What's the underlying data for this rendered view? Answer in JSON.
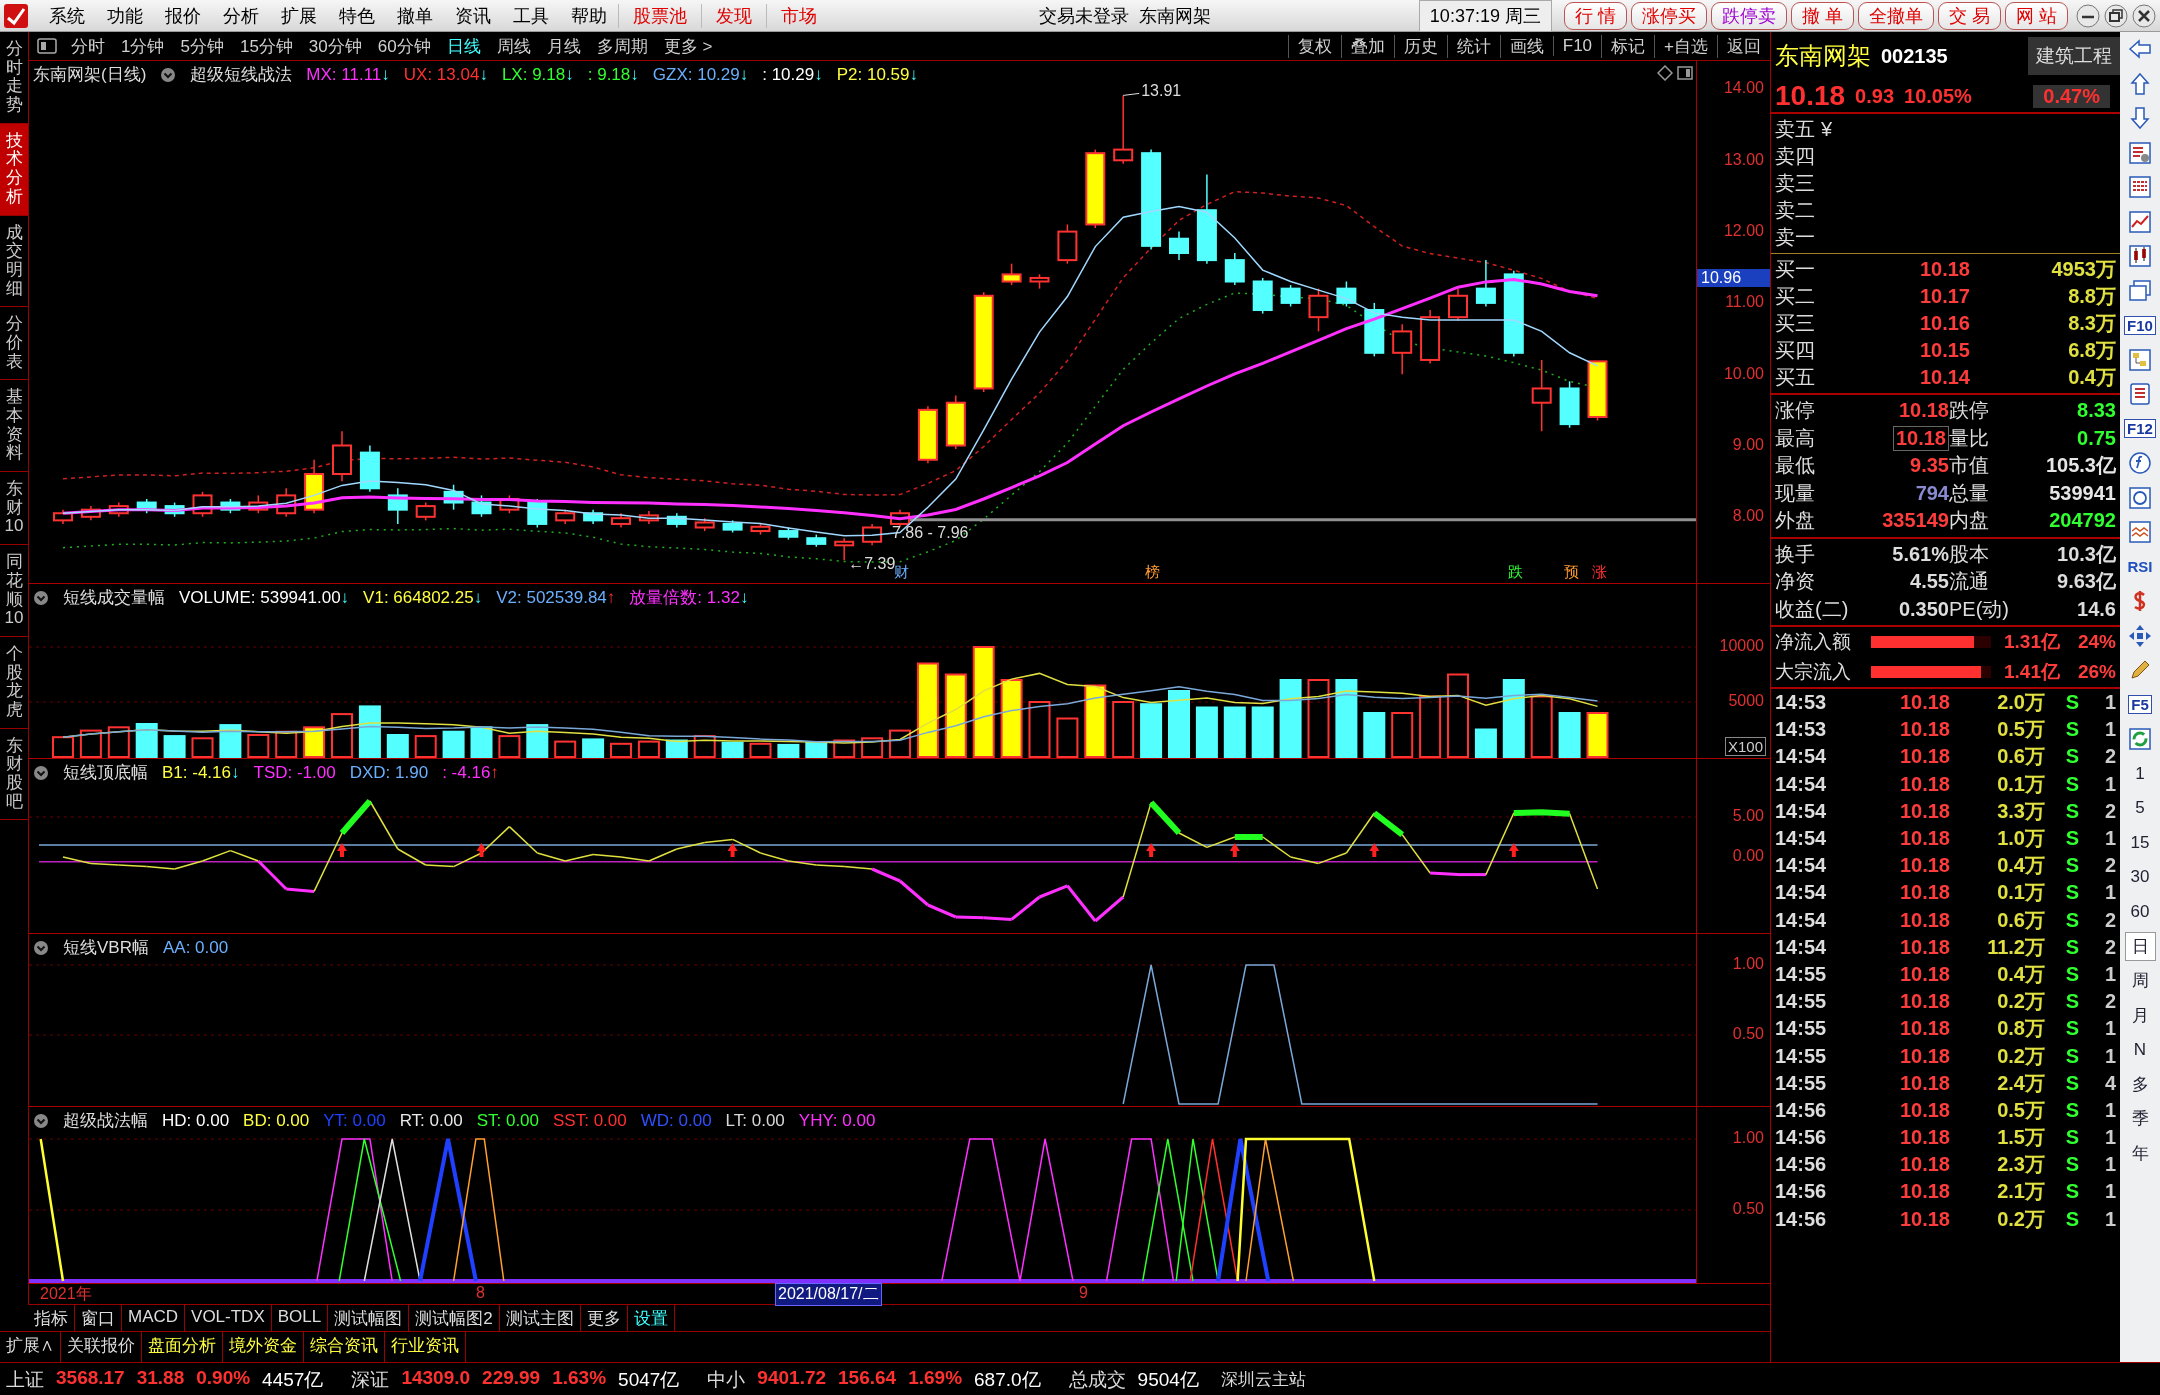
{
  "menu_bar": {
    "items": [
      {
        "label": "系统",
        "kind": "normal"
      },
      {
        "label": "功能",
        "kind": "normal"
      },
      {
        "label": "报价",
        "kind": "normal"
      },
      {
        "label": "分析",
        "kind": "normal"
      },
      {
        "label": "扩展",
        "kind": "normal"
      },
      {
        "label": "特色",
        "kind": "normal"
      },
      {
        "label": "撤单",
        "kind": "normal"
      },
      {
        "label": "资讯",
        "kind": "normal"
      },
      {
        "label": "工具",
        "kind": "normal"
      },
      {
        "label": "帮助",
        "kind": "normal"
      },
      {
        "label": "股票池",
        "kind": "highlight"
      },
      {
        "label": "发现",
        "kind": "highlight"
      },
      {
        "label": "市场",
        "kind": "highlight"
      }
    ],
    "status": "交易未登录  东南网架",
    "clock": "10:37:19 周三",
    "quick_buttons": [
      {
        "label": "行 情",
        "kind": "normal"
      },
      {
        "label": "涨停买",
        "kind": "normal"
      },
      {
        "label": "跌停卖",
        "kind": "accent"
      },
      {
        "label": "撤 单",
        "kind": "normal"
      },
      {
        "label": "全撤单",
        "kind": "normal"
      },
      {
        "label": "交 易",
        "kind": "normal"
      },
      {
        "label": "网 站",
        "kind": "normal"
      }
    ]
  },
  "period_tabs": [
    {
      "label": "分时",
      "selected": false
    },
    {
      "label": "1分钟",
      "selected": false
    },
    {
      "label": "5分钟",
      "selected": false
    },
    {
      "label": "15分钟",
      "selected": false
    },
    {
      "label": "30分钟",
      "selected": false
    },
    {
      "label": "60分钟",
      "selected": false
    },
    {
      "label": "日线",
      "selected": true
    },
    {
      "label": "周线",
      "selected": false
    },
    {
      "label": "月线",
      "selected": false
    },
    {
      "label": "多周期",
      "selected": false
    },
    {
      "label": "更多 >",
      "selected": false
    }
  ],
  "chart_tools": [
    "复权",
    "叠加",
    "历史",
    "统计",
    "画线",
    "F10",
    "标记",
    "+自选",
    "返回"
  ],
  "side_tabs": [
    {
      "label": "分时走势",
      "selected": false
    },
    {
      "label": "技术分析",
      "selected": true
    },
    {
      "label": "成交明细",
      "selected": false
    },
    {
      "label": "分价表",
      "selected": false
    },
    {
      "label": "基本资料",
      "selected": false
    },
    {
      "label": "东财10",
      "selected": false
    },
    {
      "label": "同花顺10",
      "selected": false
    },
    {
      "label": "个股龙虎",
      "selected": false
    },
    {
      "label": "东财股吧",
      "selected": false
    }
  ],
  "main_chart": {
    "title": "东南网架(日线)",
    "formula": "超级短线战法",
    "legend": [
      {
        "text": "MX: 11.11",
        "arrow": "↓",
        "kind": "down",
        "color": "#ff30ff"
      },
      {
        "text": "UX: 13.04",
        "arrow": "↓",
        "kind": "down",
        "color": "#ff3030"
      },
      {
        "text": "LX: 9.18",
        "arrow": "↓",
        "kind": "down",
        "color": "#30ff30"
      },
      {
        "text": ": 9.18",
        "arrow": "↓",
        "kind": "down",
        "color": "#30ff30"
      },
      {
        "text": "GZX: 10.29",
        "arrow": "↓",
        "kind": "down",
        "color": "#6ab0ff"
      },
      {
        "text": ": 10.29",
        "arrow": "↓",
        "kind": "down",
        "color": "#ffffff"
      },
      {
        "text": "P2: 10.59",
        "arrow": "↓",
        "kind": "down",
        "color": "#ffff40"
      }
    ],
    "axis": [
      "14.00",
      "13.00",
      "12.00",
      "11.00",
      "10.00",
      "9.00",
      "8.00"
    ],
    "price_tag": "10.96",
    "peak_label": "13.91",
    "range_label": "7.86 - 7.96",
    "low_label": "7.39",
    "low_arrow": "←",
    "markers": [
      {
        "text": "财",
        "kind": "news"
      },
      {
        "text": "榜",
        "kind": "rank"
      },
      {
        "text": "跌",
        "kind": "fall"
      },
      {
        "text": "预",
        "kind": "notice"
      },
      {
        "text": "涨",
        "kind": "rise"
      }
    ]
  },
  "volume_panel": {
    "title": "短线成交量幅",
    "legend": [
      {
        "text": "VOLUME: 539941.00",
        "arrow": "↓",
        "kind": "down",
        "color": "#ffffff"
      },
      {
        "text": "V1: 664802.25",
        "arrow": "↓",
        "kind": "down",
        "color": "#ffff40"
      },
      {
        "text": "V2: 502539.84",
        "arrow": "↑",
        "kind": "up",
        "color": "#6ab0ff"
      },
      {
        "text": "放量倍数: 1.32",
        "arrow": "↓",
        "kind": "down",
        "color": "#ff30ff"
      }
    ],
    "axis": [
      "10000",
      "5000"
    ],
    "unit": "X100"
  },
  "signal_panel": {
    "title": "短线顶底幅",
    "legend": [
      {
        "text": "B1: -4.16",
        "arrow": "↓",
        "kind": "down",
        "color": "#ffff40"
      },
      {
        "text": "TSD: -1.00",
        "color": "#ff30ff"
      },
      {
        "text": "DXD: 1.90",
        "color": "#6ab0ff"
      },
      {
        "text": ": -4.16",
        "arrow": "↑",
        "kind": "up",
        "color": "#ff30ff"
      }
    ],
    "axis": [
      "5.00",
      "0.00"
    ]
  },
  "vbr_panel": {
    "title": "短线VBR幅",
    "legend": [
      {
        "text": "AA: 0.00",
        "color": "#6ab0ff"
      }
    ],
    "axis": [
      "1.00",
      "0.50"
    ]
  },
  "strategy_panel": {
    "title": "超级战法幅",
    "legend": [
      {
        "text": "HD: 0.00",
        "color": "#ffffff"
      },
      {
        "text": "BD: 0.00",
        "color": "#ffff40"
      },
      {
        "text": "YT: 0.00",
        "color": "#2040ff"
      },
      {
        "text": "RT: 0.00",
        "color": "#e8e8e8"
      },
      {
        "text": "ST: 0.00",
        "color": "#30ff30"
      },
      {
        "text": "SST: 0.00",
        "color": "#ff3030"
      },
      {
        "text": "WD: 0.00",
        "color": "#3050ff"
      },
      {
        "text": "LT: 0.00",
        "color": "#d8d8d8"
      },
      {
        "text": "YHY: 0.00",
        "color": "#ff30ff"
      }
    ],
    "axis": [
      "1.00",
      "0.50"
    ]
  },
  "date_axis": [
    {
      "label": "2021年",
      "kind": "year"
    },
    {
      "label": "8",
      "kind": "month"
    },
    {
      "label": "2021/08/17/二",
      "kind": "cursor"
    },
    {
      "label": "9",
      "kind": "month"
    }
  ],
  "indicator_tabs": [
    {
      "label": "指标",
      "kind": "normal"
    },
    {
      "label": "窗口",
      "kind": "normal"
    },
    {
      "label": "MACD",
      "kind": "normal"
    },
    {
      "label": "VOL-TDX",
      "kind": "normal"
    },
    {
      "label": "BOLL",
      "kind": "normal"
    },
    {
      "label": "测试幅图",
      "kind": "normal"
    },
    {
      "label": "测试幅图2",
      "kind": "normal"
    },
    {
      "label": "测试主图",
      "kind": "normal"
    },
    {
      "label": "更多",
      "kind": "normal"
    },
    {
      "label": "设置",
      "kind": "accent"
    }
  ],
  "extension_tabs": [
    {
      "label": "扩展∧",
      "kind": "normal"
    },
    {
      "label": "关联报价",
      "kind": "normal"
    },
    {
      "label": "盘面分析",
      "kind": "accent"
    },
    {
      "label": "境外资金",
      "kind": "accent"
    },
    {
      "label": "综合资讯",
      "kind": "accent"
    },
    {
      "label": "行业资讯",
      "kind": "accent"
    }
  ],
  "quote": {
    "name": "东南网架",
    "code": "002135",
    "sector": "建筑工程",
    "price": "10.18",
    "change": "0.93",
    "pct": "10.05%",
    "sector_pct": "0.47%"
  },
  "sell_levels": [
    {
      "label": "卖五"
    },
    {
      "label": "卖四"
    },
    {
      "label": "卖三"
    },
    {
      "label": "卖二"
    },
    {
      "label": "卖一"
    }
  ],
  "currency": "¥",
  "buy_levels": [
    {
      "label": "买一",
      "price": "10.18",
      "volume": "4953万"
    },
    {
      "label": "买二",
      "price": "10.17",
      "volume": "8.8万"
    },
    {
      "label": "买三",
      "price": "10.16",
      "volume": "8.3万"
    },
    {
      "label": "买四",
      "price": "10.15",
      "volume": "6.8万"
    },
    {
      "label": "买五",
      "price": "10.14",
      "volume": "0.4万"
    }
  ],
  "stats": [
    {
      "cells": [
        {
          "label": "涨停",
          "value": "10.18",
          "color": "#ff3c3c",
          "boxed": false
        },
        {
          "label": "跌停",
          "value": "8.33",
          "color": "#30ff30",
          "boxed": false
        }
      ]
    },
    {
      "cells": [
        {
          "label": "最高",
          "value": "10.18",
          "color": "#ff3c3c",
          "boxed": true
        },
        {
          "label": "量比",
          "value": "0.75",
          "color": "#30ff30",
          "boxed": false
        }
      ]
    },
    {
      "cells": [
        {
          "label": "最低",
          "value": "9.35",
          "color": "#ff3c3c",
          "boxed": false
        },
        {
          "label": "市值",
          "value": "105.3亿",
          "color": "#e6e6e6",
          "boxed": false
        }
      ]
    },
    {
      "cells": [
        {
          "label": "现量",
          "value": "794",
          "color": "#8a8ad0",
          "boxed": false
        },
        {
          "label": "总量",
          "value": "539941",
          "color": "#e6e6e6",
          "boxed": false
        }
      ]
    },
    {
      "cells": [
        {
          "label": "外盘",
          "value": "335149",
          "color": "#ff3c3c",
          "boxed": false
        },
        {
          "label": "内盘",
          "value": "204792",
          "color": "#30ff30",
          "boxed": false
        }
      ]
    }
  ],
  "fundamentals": [
    {
      "label": "换手",
      "value": "5.61%",
      "label2": "股本",
      "value2": "10.3亿"
    },
    {
      "label": "净资",
      "value": "4.55",
      "label2": "流通",
      "value2": "9.63亿"
    },
    {
      "label": "收益(二)",
      "value": "0.350",
      "label2": "PE(动)",
      "value2": "14.6"
    }
  ],
  "flows": [
    {
      "label": "净流入额",
      "level": 0.86,
      "amount": "1.31亿",
      "pct": "24%"
    },
    {
      "label": "大宗流入",
      "level": 0.92,
      "amount": "1.41亿",
      "pct": "26%"
    }
  ],
  "ticks": [
    {
      "time": "14:53",
      "price": "10.18",
      "volume": "2.0万",
      "side": "S",
      "count": "1"
    },
    {
      "time": "14:53",
      "price": "10.18",
      "volume": "0.5万",
      "side": "S",
      "count": "1"
    },
    {
      "time": "14:54",
      "price": "10.18",
      "volume": "0.6万",
      "side": "S",
      "count": "2"
    },
    {
      "time": "14:54",
      "price": "10.18",
      "volume": "0.1万",
      "side": "S",
      "count": "1"
    },
    {
      "time": "14:54",
      "price": "10.18",
      "volume": "3.3万",
      "side": "S",
      "count": "2"
    },
    {
      "time": "14:54",
      "price": "10.18",
      "volume": "1.0万",
      "side": "S",
      "count": "1"
    },
    {
      "time": "14:54",
      "price": "10.18",
      "volume": "0.4万",
      "side": "S",
      "count": "2"
    },
    {
      "time": "14:54",
      "price": "10.18",
      "volume": "0.1万",
      "side": "S",
      "count": "1"
    },
    {
      "time": "14:54",
      "price": "10.18",
      "volume": "0.6万",
      "side": "S",
      "count": "2"
    },
    {
      "time": "14:54",
      "price": "10.18",
      "volume": "11.2万",
      "side": "S",
      "count": "2"
    },
    {
      "time": "14:55",
      "price": "10.18",
      "volume": "0.4万",
      "side": "S",
      "count": "1"
    },
    {
      "time": "14:55",
      "price": "10.18",
      "volume": "0.2万",
      "side": "S",
      "count": "2"
    },
    {
      "time": "14:55",
      "price": "10.18",
      "volume": "0.8万",
      "side": "S",
      "count": "1"
    },
    {
      "time": "14:55",
      "price": "10.18",
      "volume": "0.2万",
      "side": "S",
      "count": "1"
    },
    {
      "time": "14:55",
      "price": "10.18",
      "volume": "2.4万",
      "side": "S",
      "count": "4"
    },
    {
      "time": "14:56",
      "price": "10.18",
      "volume": "0.5万",
      "side": "S",
      "count": "1"
    },
    {
      "time": "14:56",
      "price": "10.18",
      "volume": "1.5万",
      "side": "S",
      "count": "1"
    },
    {
      "time": "14:56",
      "price": "10.18",
      "volume": "2.3万",
      "side": "S",
      "count": "1"
    },
    {
      "time": "14:56",
      "price": "10.18",
      "volume": "2.1万",
      "side": "S",
      "count": "1"
    },
    {
      "time": "14:56",
      "price": "10.18",
      "volume": "0.2万",
      "side": "S",
      "count": "1"
    }
  ],
  "tool_strip": {
    "labels": [
      "F10",
      "F12",
      "RSI",
      "F5"
    ],
    "periods": [
      {
        "label": "1",
        "selected": false
      },
      {
        "label": "5",
        "selected": false
      },
      {
        "label": "15",
        "selected": false
      },
      {
        "label": "30",
        "selected": false
      },
      {
        "label": "60",
        "selected": false
      },
      {
        "label": "日",
        "selected": true
      },
      {
        "label": "周",
        "selected": false
      },
      {
        "label": "月",
        "selected": false
      },
      {
        "label": "N",
        "selected": false
      },
      {
        "label": "多",
        "selected": false
      },
      {
        "label": "季",
        "selected": false
      },
      {
        "label": "年",
        "selected": false
      }
    ]
  },
  "status_bar": {
    "indices": [
      {
        "name": "上证",
        "value": "3568.17",
        "change": "31.88",
        "pct": "0.90%",
        "amount": "4457亿"
      },
      {
        "name": "深证",
        "value": "14309.0",
        "change": "229.99",
        "pct": "1.63%",
        "amount": "5047亿"
      },
      {
        "name": "中小",
        "value": "9401.72",
        "change": "156.64",
        "pct": "1.69%",
        "amount": "687.0亿"
      }
    ],
    "total_label": "总成交",
    "total_value": "9504亿",
    "server": "深圳云主站"
  }
}
